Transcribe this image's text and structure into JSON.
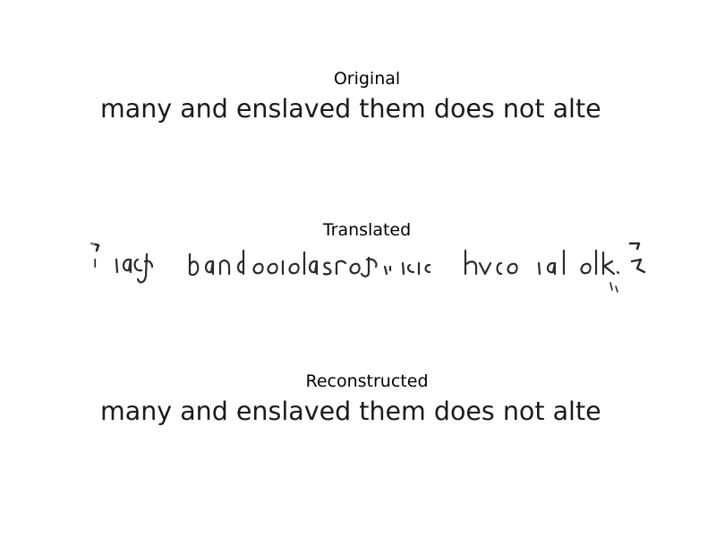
{
  "panels": {
    "original": {
      "title": "Original",
      "text": "many and enslaved them does not alte"
    },
    "translated": {
      "title": "Translated"
    },
    "reconstructed": {
      "title": "Reconstructed",
      "text": "many and enslaved them does not alte"
    }
  },
  "colors": {
    "background": "#ffffff",
    "ink": "#1a1a1a",
    "title": "#000000"
  }
}
